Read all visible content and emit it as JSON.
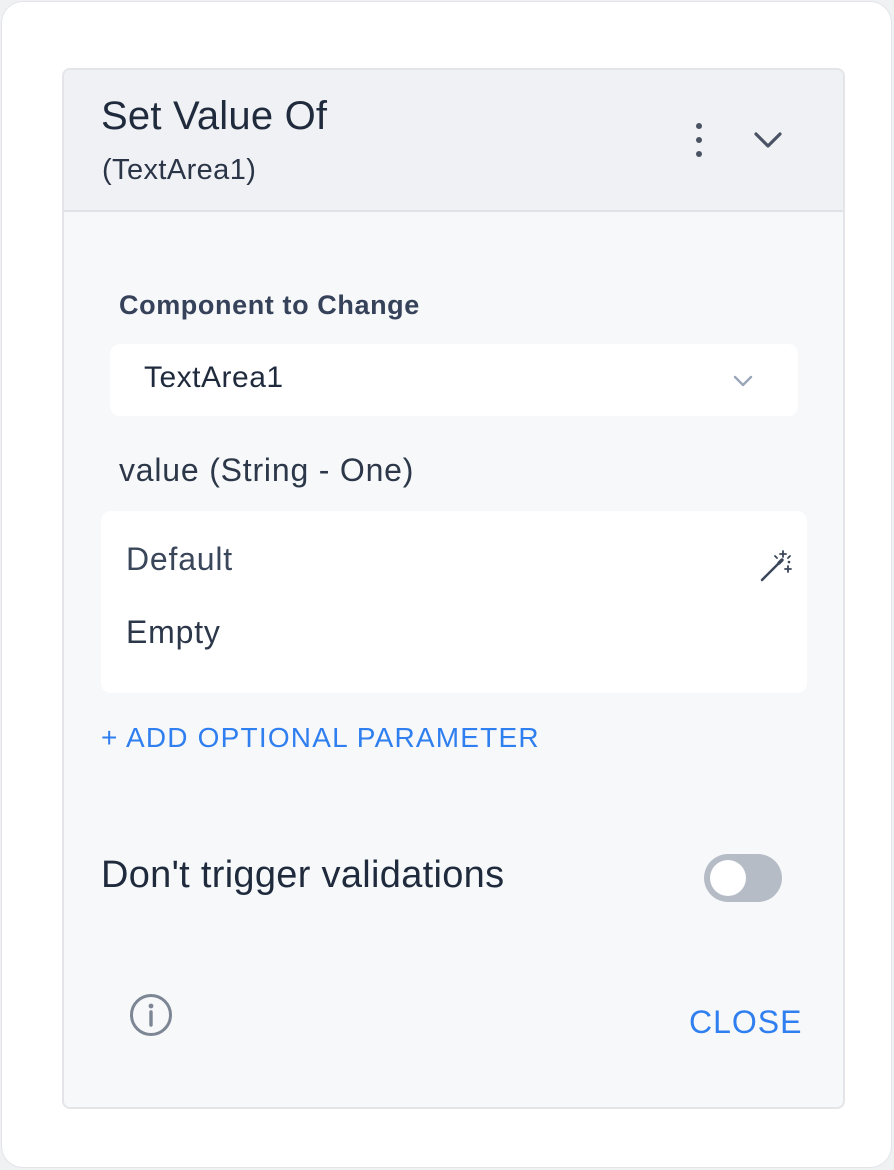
{
  "action": {
    "title": "Set Value Of",
    "subtitle": "(TextArea1)",
    "more_icon": "kebab-vertical-icon",
    "collapse_icon": "chevron-down-icon"
  },
  "component_field": {
    "label": "Component to Change",
    "value": "TextArea1",
    "icon": "chevron-down-icon"
  },
  "parameter": {
    "label": "value (String - One)",
    "line1": "Default",
    "line2": "Empty",
    "icon": "magic-wand-icon"
  },
  "add_parameter_label": "+ ADD OPTIONAL PARAMETER",
  "validation_toggle": {
    "label": "Don't trigger validations",
    "on": false
  },
  "footer": {
    "info_icon": "info-icon",
    "close_label": "CLOSE"
  },
  "colors": {
    "accent": "#2f7ff0",
    "text": "#1f2b3d",
    "toggle_off": "#b6bcc6"
  }
}
